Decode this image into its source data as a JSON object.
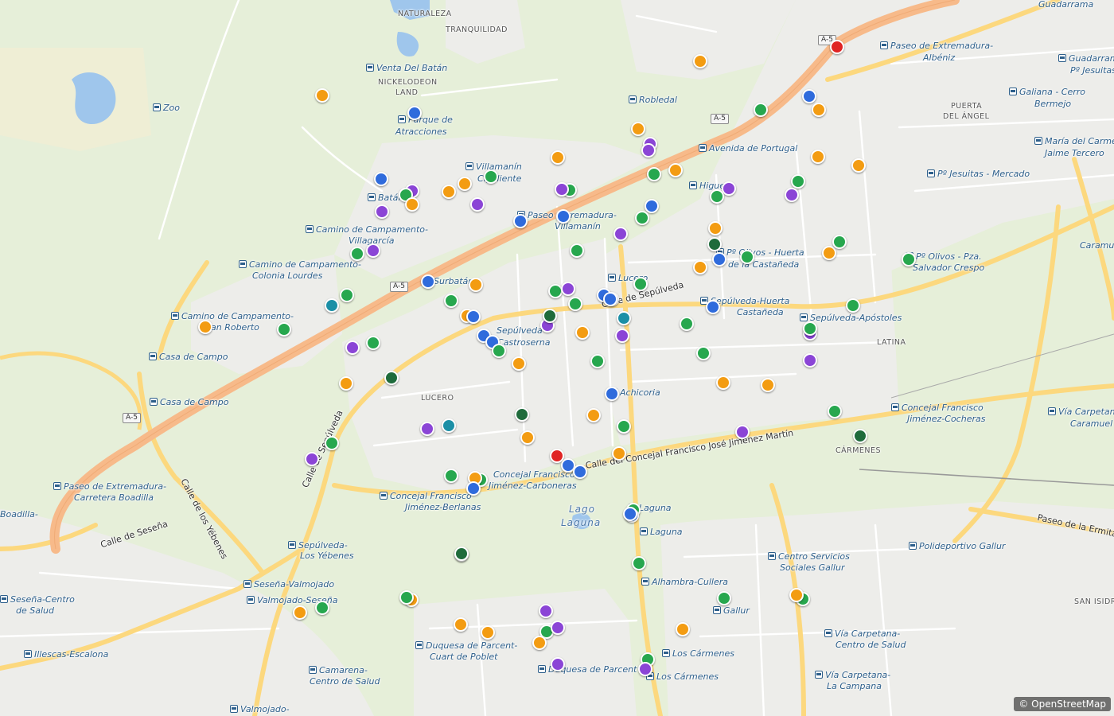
{
  "map": {
    "attribution": "© OpenStreetMap",
    "colors": {
      "park": "#e6efd9",
      "urban": "#ededea",
      "major_road": "#f7ba8a",
      "road": "#fcd87e",
      "water": "#9fc6ec",
      "orange": "#f39c12",
      "blue": "#2f6bdc",
      "purple": "#8b45d6",
      "green": "#27a74e",
      "darkgreen": "#1f6b3b",
      "teal": "#1b8fa6",
      "red": "#e02424"
    },
    "labels": [
      {
        "text": "NATURALEZA",
        "kind": "nb"
      },
      {
        "text": "TRANQUILIDAD",
        "kind": "nb"
      },
      {
        "text": "Venta Del Batán",
        "kind": "stop"
      },
      {
        "text": "NICKELODEON",
        "kind": "nb"
      },
      {
        "text": "LAND",
        "kind": "nb"
      },
      {
        "text": "Zoo",
        "kind": "stop"
      },
      {
        "text": "Parque de",
        "kind": "stop"
      },
      {
        "text": "Atracciones",
        "kind": "place"
      },
      {
        "text": "Robledal",
        "kind": "stop"
      },
      {
        "text": "Paseo de Extremadura-",
        "kind": "stop"
      },
      {
        "text": "Albéniz",
        "kind": "place"
      },
      {
        "text": "Guadarrama",
        "kind": "place"
      },
      {
        "text": "Guadarrama -",
        "kind": "stop"
      },
      {
        "text": "Pº Jesuitas",
        "kind": "place"
      },
      {
        "text": "PUERTA",
        "kind": "nb"
      },
      {
        "text": "DEL ÁNGEL",
        "kind": "nb"
      },
      {
        "text": "Galiana - Cerro",
        "kind": "stop"
      },
      {
        "text": "Bermejo",
        "kind": "place"
      },
      {
        "text": "Avenida de Portugal",
        "kind": "stop"
      },
      {
        "text": "María del Carmen",
        "kind": "stop"
      },
      {
        "text": "Jaime Tercero",
        "kind": "place"
      },
      {
        "text": "Pº Jesuitas - Mercado",
        "kind": "stop"
      },
      {
        "text": "Villamanín",
        "kind": "stop"
      },
      {
        "text": "Cigaliente",
        "kind": "place"
      },
      {
        "text": "Batán",
        "kind": "stop"
      },
      {
        "text": "Paseo Extremadura-",
        "kind": "stop"
      },
      {
        "text": "Villamanín",
        "kind": "place"
      },
      {
        "text": "Higuera",
        "kind": "stop"
      },
      {
        "text": "Camino de Campamento-",
        "kind": "stop"
      },
      {
        "text": "Villagarcía",
        "kind": "place"
      },
      {
        "text": "Pº Olivos - Pza.",
        "kind": "stop"
      },
      {
        "text": "Salvador Crespo",
        "kind": "place"
      },
      {
        "text": "Camino de Campamento-",
        "kind": "stop"
      },
      {
        "text": "Colonia Lourdes",
        "kind": "place"
      },
      {
        "text": "Pº Olivos - Huerta",
        "kind": "stop"
      },
      {
        "text": "de la Castañeda",
        "kind": "place"
      },
      {
        "text": "Caramuel",
        "kind": "place"
      },
      {
        "text": "Calle de Sepúlveda",
        "kind": "street"
      },
      {
        "text": "Surbatán",
        "kind": "stop"
      },
      {
        "text": "Lucero",
        "kind": "stop"
      },
      {
        "text": "Sepúlveda-Huerta",
        "kind": "stop"
      },
      {
        "text": "Castañeda",
        "kind": "place"
      },
      {
        "text": "Camino de Campamento-",
        "kind": "stop"
      },
      {
        "text": "San Roberto",
        "kind": "place"
      },
      {
        "text": "Sepúlveda-",
        "kind": "place"
      },
      {
        "text": "Castroserna",
        "kind": "place"
      },
      {
        "text": "Sepúlveda-Apóstoles",
        "kind": "stop"
      },
      {
        "text": "LATINA",
        "kind": "nb"
      },
      {
        "text": "Casa de Campo",
        "kind": "stop"
      },
      {
        "text": "Casa de Campo",
        "kind": "stop"
      },
      {
        "text": "Achicoria",
        "kind": "stop"
      },
      {
        "text": "LUCERO",
        "kind": "nb"
      },
      {
        "text": "Concejal Francisco",
        "kind": "stop"
      },
      {
        "text": "Jiménez-Cocheras",
        "kind": "place"
      },
      {
        "text": "Vía Carpetana-",
        "kind": "stop"
      },
      {
        "text": "Caramuel",
        "kind": "place"
      },
      {
        "text": "CÁRMENES",
        "kind": "nb"
      },
      {
        "text": "Calle del Concejal Francisco José Jiménez Martín",
        "kind": "street"
      },
      {
        "text": "Paseo de Extremadura-",
        "kind": "stop"
      },
      {
        "text": "Carretera Boadilla",
        "kind": "place"
      },
      {
        "text": "Calle de los Yébenes",
        "kind": "street"
      },
      {
        "text": "Calle de Sepúlveda",
        "kind": "street"
      },
      {
        "text": "Concejal Francisco",
        "kind": "place"
      },
      {
        "text": "Jiménez-Carboneras",
        "kind": "place"
      },
      {
        "text": "Concejal Francisco",
        "kind": "stop"
      },
      {
        "text": "Jiménez-Berlanas",
        "kind": "place"
      },
      {
        "text": "Lago",
        "kind": "lake"
      },
      {
        "text": "Laguna",
        "kind": "lake"
      },
      {
        "text": "Laguna",
        "kind": "stop"
      },
      {
        "text": "Laguna",
        "kind": "stop"
      },
      {
        "text": "Paseo de la Ermita",
        "kind": "street"
      },
      {
        "text": "Boadilla-",
        "kind": "place"
      },
      {
        "text": "Calle de Seseña",
        "kind": "street"
      },
      {
        "text": "Sepúlveda-",
        "kind": "stop"
      },
      {
        "text": "Los Yébenes",
        "kind": "place"
      },
      {
        "text": "Polideportivo Gallur",
        "kind": "stop"
      },
      {
        "text": "Centro Servicios",
        "kind": "stop"
      },
      {
        "text": "Sociales Gallur",
        "kind": "place"
      },
      {
        "text": "Seseña-Valmojado",
        "kind": "stop"
      },
      {
        "text": "Valmojado-Seseña",
        "kind": "stop"
      },
      {
        "text": "Alhambra-Cullera",
        "kind": "stop"
      },
      {
        "text": "Seseña-Centro",
        "kind": "stop"
      },
      {
        "text": "de Salud",
        "kind": "place"
      },
      {
        "text": "Gallur",
        "kind": "stop"
      },
      {
        "text": "SAN ISIDRO",
        "kind": "nb"
      },
      {
        "text": "Duquesa de Parcent-",
        "kind": "stop"
      },
      {
        "text": "Cuart de Poblet",
        "kind": "place"
      },
      {
        "text": "Vía Carpetana-",
        "kind": "stop"
      },
      {
        "text": "Centro de Salud",
        "kind": "place"
      },
      {
        "text": "Illescas-Escalona",
        "kind": "stop"
      },
      {
        "text": "Los Cármenes",
        "kind": "stop"
      },
      {
        "text": "Camarena-",
        "kind": "stop"
      },
      {
        "text": "Centro de Salud",
        "kind": "place"
      },
      {
        "text": "Duquesa de Parcent",
        "kind": "stop"
      },
      {
        "text": "Los Cármenes",
        "kind": "stop"
      },
      {
        "text": "Vía Carpetana-",
        "kind": "stop"
      },
      {
        "text": "La Campana",
        "kind": "place"
      },
      {
        "text": "Valmojado-",
        "kind": "stop"
      }
    ],
    "shields": [
      "A-5",
      "A-5",
      "A-5",
      "A-5"
    ],
    "markers": [
      {
        "color": "red"
      },
      {
        "color": "orange"
      },
      {
        "color": "orange"
      },
      {
        "color": "blue"
      },
      {
        "color": "blue"
      },
      {
        "color": "orange"
      },
      {
        "color": "green"
      },
      {
        "color": "orange"
      },
      {
        "color": "orange"
      },
      {
        "color": "purple"
      },
      {
        "color": "purple"
      },
      {
        "color": "orange"
      },
      {
        "color": "orange"
      },
      {
        "color": "orange"
      },
      {
        "color": "green"
      },
      {
        "color": "green"
      },
      {
        "color": "green"
      },
      {
        "color": "blue"
      },
      {
        "color": "purple"
      },
      {
        "color": "green"
      },
      {
        "color": "orange"
      },
      {
        "color": "orange"
      },
      {
        "color": "orange"
      },
      {
        "color": "purple"
      },
      {
        "color": "purple"
      },
      {
        "color": "purple"
      },
      {
        "color": "green"
      },
      {
        "color": "green"
      },
      {
        "color": "purple"
      },
      {
        "color": "blue"
      },
      {
        "color": "blue"
      },
      {
        "color": "green"
      },
      {
        "color": "orange"
      },
      {
        "color": "purple"
      },
      {
        "color": "orange"
      },
      {
        "color": "darkgreen"
      },
      {
        "color": "green"
      },
      {
        "color": "green"
      },
      {
        "color": "blue"
      },
      {
        "color": "orange"
      },
      {
        "color": "green"
      },
      {
        "color": "green"
      },
      {
        "color": "purple"
      },
      {
        "color": "purple"
      },
      {
        "color": "green"
      },
      {
        "color": "green"
      },
      {
        "color": "blue"
      },
      {
        "color": "orange"
      },
      {
        "color": "green"
      },
      {
        "color": "green"
      },
      {
        "color": "teal"
      },
      {
        "color": "orange"
      },
      {
        "color": "green"
      },
      {
        "color": "purple"
      },
      {
        "color": "green"
      },
      {
        "color": "blue"
      },
      {
        "color": "blue"
      },
      {
        "color": "orange"
      },
      {
        "color": "green"
      },
      {
        "color": "purple"
      },
      {
        "color": "green"
      },
      {
        "color": "purple"
      },
      {
        "color": "green"
      },
      {
        "color": "purple"
      },
      {
        "color": "darkgreen"
      },
      {
        "color": "blue"
      },
      {
        "color": "blue"
      },
      {
        "color": "blue"
      },
      {
        "color": "green"
      },
      {
        "color": "blue"
      },
      {
        "color": "purple"
      },
      {
        "color": "orange"
      },
      {
        "color": "teal"
      },
      {
        "color": "purple"
      },
      {
        "color": "blue"
      },
      {
        "color": "blue"
      },
      {
        "color": "green"
      },
      {
        "color": "orange"
      },
      {
        "color": "green"
      },
      {
        "color": "green"
      },
      {
        "color": "green"
      },
      {
        "color": "darkgreen"
      },
      {
        "color": "purple"
      },
      {
        "color": "darkgreen"
      },
      {
        "color": "orange"
      },
      {
        "color": "green"
      },
      {
        "color": "blue"
      },
      {
        "color": "orange"
      },
      {
        "color": "orange"
      },
      {
        "color": "darkgreen"
      },
      {
        "color": "orange"
      },
      {
        "color": "purple"
      },
      {
        "color": "teal"
      },
      {
        "color": "green"
      },
      {
        "color": "green"
      },
      {
        "color": "purple"
      },
      {
        "color": "green"
      },
      {
        "color": "orange"
      },
      {
        "color": "green"
      },
      {
        "color": "darkgreen"
      },
      {
        "color": "orange"
      },
      {
        "color": "red"
      },
      {
        "color": "blue"
      },
      {
        "color": "blue"
      },
      {
        "color": "orange"
      },
      {
        "color": "green"
      },
      {
        "color": "blue"
      },
      {
        "color": "orange"
      },
      {
        "color": "blue"
      },
      {
        "color": "blue"
      },
      {
        "color": "darkgreen"
      },
      {
        "color": "green"
      },
      {
        "color": "green"
      },
      {
        "color": "orange"
      },
      {
        "color": "green"
      },
      {
        "color": "orange"
      },
      {
        "color": "green"
      },
      {
        "color": "orange"
      },
      {
        "color": "orange"
      },
      {
        "color": "purple"
      },
      {
        "color": "green"
      },
      {
        "color": "orange"
      },
      {
        "color": "purple"
      },
      {
        "color": "green"
      },
      {
        "color": "orange"
      },
      {
        "color": "purple"
      },
      {
        "color": "green"
      },
      {
        "color": "purple"
      }
    ]
  }
}
